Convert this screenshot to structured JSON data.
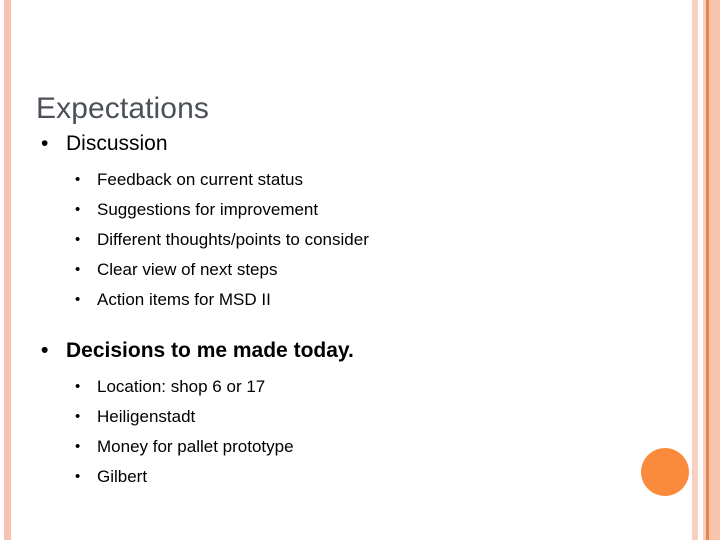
{
  "slide": {
    "title": "Expectations",
    "bullet_glyph": "•",
    "colors": {
      "title_text": "#4b5157",
      "body_text": "#000000",
      "stripe_light": "#f7c3b0",
      "stripe_accent": "#e8854a",
      "accent_circle": "#fb8b3c",
      "background": "#ffffff"
    },
    "groups": [
      {
        "heading": "Discussion",
        "bold": false,
        "items": [
          "Feedback on current status",
          "Suggestions for improvement",
          "Different thoughts/points to consider",
          "Clear view of next steps",
          "Action items for MSD II"
        ]
      },
      {
        "heading": "Decisions to me made today.",
        "bold": true,
        "items": [
          "Location: shop 6 or 17",
          "Heiligenstadt",
          "Money for pallet prototype",
          "Gilbert"
        ]
      }
    ]
  }
}
